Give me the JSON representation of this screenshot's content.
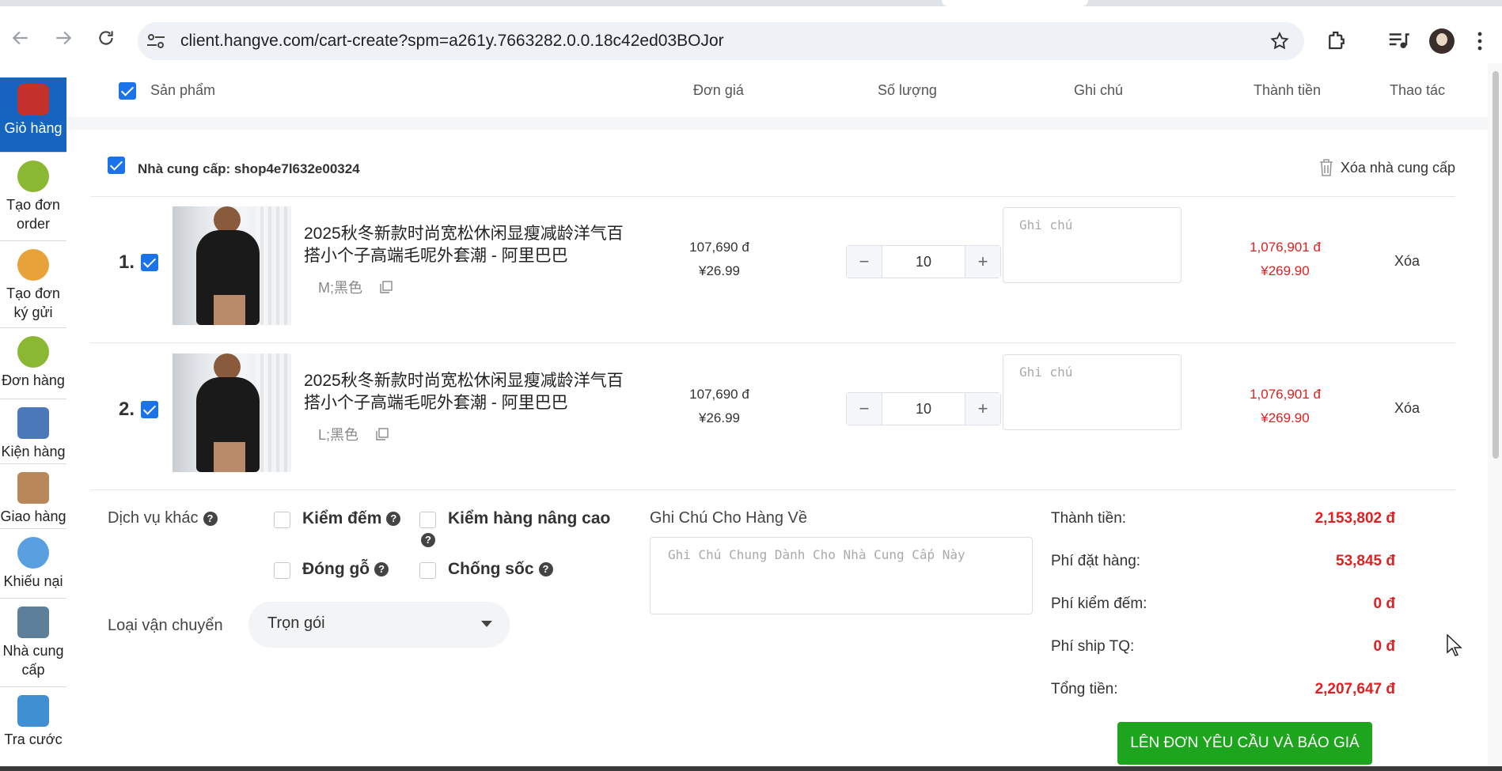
{
  "browser": {
    "url": "client.hangve.com/cart-create?spm=a261y.7663282.0.0.18c42ed03BOJor"
  },
  "sidebar": {
    "items": [
      {
        "label": "Giỏ hàng"
      },
      {
        "label": "Tạo đơn order"
      },
      {
        "label": "Tạo đơn ký gửi"
      },
      {
        "label": "Đơn hàng"
      },
      {
        "label": "Kiện hàng"
      },
      {
        "label": "Giao hàng"
      },
      {
        "label": "Khiếu nại"
      },
      {
        "label": "Nhà cung cấp"
      },
      {
        "label": "Tra cước"
      }
    ]
  },
  "table_header": {
    "product": "Sản phẩm",
    "unit_price": "Đơn giá",
    "quantity": "Số lượng",
    "note": "Ghi chú",
    "total": "Thành tiền",
    "action": "Thao tác"
  },
  "supplier": {
    "label": "Nhà cung cấp: shop4e7l632e00324",
    "delete_label": "Xóa nhà cung cấp"
  },
  "items": [
    {
      "index": "1.",
      "title": "2025秋冬新款时尚宽松休闲显瘦减龄洋气百搭小个子高端毛呢外套潮 - 阿里巴巴",
      "variant": "M;黑色",
      "price_vnd": "107,690 đ",
      "price_cny": "¥26.99",
      "quantity": "10",
      "note_placeholder": "Ghi chú",
      "amount_vnd": "1,076,901 đ",
      "amount_cny": "¥269.90",
      "delete_label": "Xóa"
    },
    {
      "index": "2.",
      "title": "2025秋冬新款时尚宽松休闲显瘦减龄洋气百搭小个子高端毛呢外套潮 - 阿里巴巴",
      "variant": "L;黑色",
      "price_vnd": "107,690 đ",
      "price_cny": "¥26.99",
      "quantity": "10",
      "note_placeholder": "Ghi chú",
      "amount_vnd": "1,076,901 đ",
      "amount_cny": "¥269.90",
      "delete_label": "Xóa"
    }
  ],
  "services": {
    "label": "Dịch vụ khác",
    "options": {
      "count": "Kiểm đếm",
      "advanced_check": "Kiểm hàng nâng cao",
      "wood": "Đóng gỗ",
      "shockproof": "Chống sốc"
    },
    "shipping_label": "Loại vận chuyển",
    "shipping_value": "Trọn gói",
    "general_note_title": "Ghi Chú Cho Hàng Về",
    "general_note_placeholder": "Ghi Chú Chung Dành Cho Nhà Cung Cấp Này"
  },
  "summary": {
    "subtotal_label": "Thành tiền:",
    "subtotal_value": "2,153,802 đ",
    "order_fee_label": "Phí đặt hàng:",
    "order_fee_value": "53,845 đ",
    "count_fee_label": "Phí kiểm đếm:",
    "count_fee_value": "0 đ",
    "ship_fee_label": "Phí ship TQ:",
    "ship_fee_value": "0 đ",
    "total_label": "Tổng tiền:",
    "total_value": "2,207,647 đ",
    "submit_label": "LÊN ĐƠN YÊU CẦU VÀ BÁO GIÁ"
  },
  "colors": {
    "accent": "#1565c0",
    "checkbox": "#1a73e8",
    "price_red": "#e02020",
    "submit_green": "#1ea51e"
  }
}
